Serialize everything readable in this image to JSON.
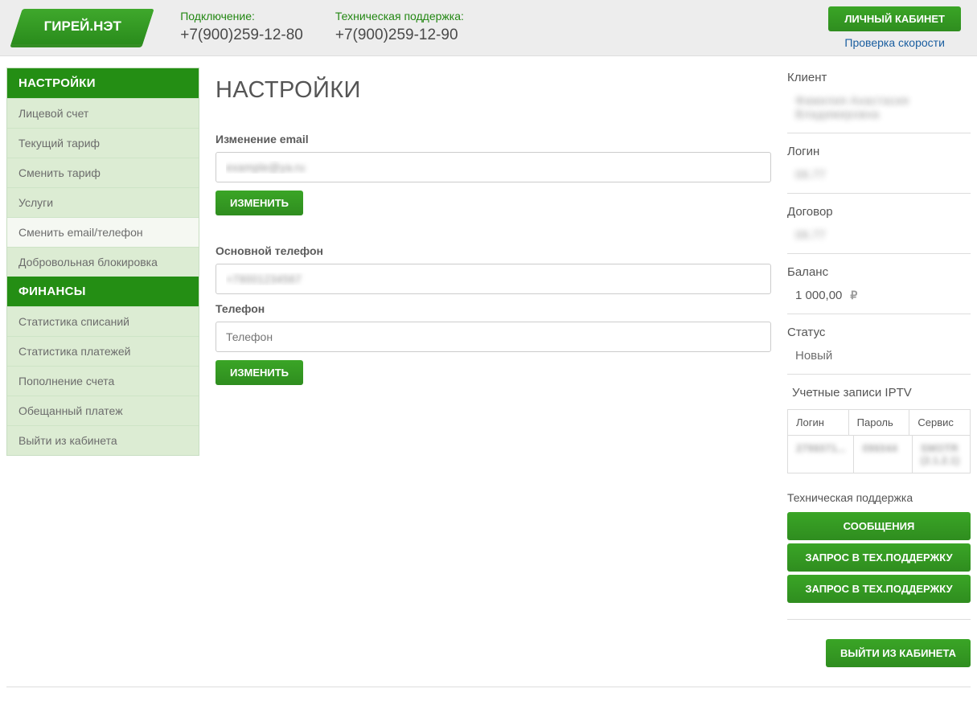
{
  "brand": "ГИРЕЙ.НЭТ",
  "top": {
    "connectLabel": "Подключение:",
    "connectPhone": "+7(900)259-12-80",
    "supportLabel": "Техническая поддержка:",
    "supportPhone": "+7(900)259-12-90",
    "cabinetButton": "ЛИЧНЫЙ КАБИНЕТ",
    "speedCheck": "Проверка скорости"
  },
  "sidebar": {
    "sections": [
      {
        "header": "НАСТРОЙКИ",
        "items": [
          "Лицевой счет",
          "Текущий тариф",
          "Сменить тариф",
          "Услуги",
          "Сменить email/телефон",
          "Добровольная блокировка"
        ],
        "activeIndex": 4
      },
      {
        "header": "ФИНАНСЫ",
        "items": [
          "Статистика списаний",
          "Статистика платежей",
          "Пополнение счета",
          "Обещанный платеж",
          "Выйти из кабинета"
        ],
        "activeIndex": -1
      }
    ]
  },
  "page": {
    "title": "НАСТРОЙКИ",
    "emailLabel": "Изменение email",
    "emailValue": "example@ya.ru",
    "changeBtn": "ИЗМЕНИТЬ",
    "mainPhoneLabel": "Основной телефон",
    "mainPhoneValue": "+79001234567",
    "phoneLabel": "Телефон",
    "phonePlaceholder": "Телефон"
  },
  "info": {
    "clientLabel": "Клиент",
    "clientValue": "Фамилия Анастасия Владимировна",
    "loginLabel": "Логин",
    "loginValue": "06.77",
    "contractLabel": "Договор",
    "contractValue": "06.77",
    "balanceLabel": "Баланс",
    "balanceValue": "1 000,00",
    "currency": "₽",
    "statusLabel": "Статус",
    "statusValue": "Новый",
    "iptvLabel": "Учетные записи IPTV",
    "iptvHeaders": [
      "Логин",
      "Пароль",
      "Сервис"
    ],
    "iptvRow": [
      "2796071...",
      "096044",
      "SMOTR (2.1.2.1)"
    ],
    "techLabel": "Техническая поддержка",
    "messagesBtn": "СООБЩЕНИЯ",
    "ticketBtn": "ЗАПРОС В ТЕХ.ПОДДЕРЖКУ",
    "logoutBtn": "ВЫЙТИ ИЗ КАБИНЕТА"
  }
}
